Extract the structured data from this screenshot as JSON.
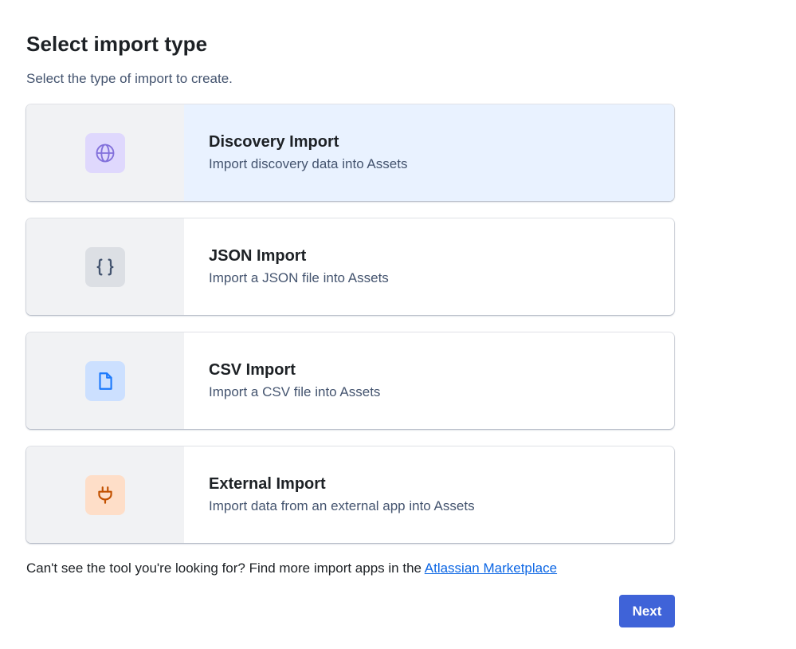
{
  "header": {
    "title": "Select import type",
    "subtitle": "Select the type of import to create."
  },
  "options": [
    {
      "title": "Discovery Import",
      "description": "Import discovery data into Assets",
      "icon": "globe-icon",
      "selected": true,
      "icon_bg": "#dfd8fd",
      "icon_color": "#8270db"
    },
    {
      "title": "JSON Import",
      "description": "Import a JSON file into Assets",
      "icon": "braces-icon",
      "selected": false,
      "icon_bg": "#dcdfe4",
      "icon_color": "#44546f"
    },
    {
      "title": "CSV Import",
      "description": "Import a CSV file into Assets",
      "icon": "file-icon",
      "selected": false,
      "icon_bg": "#cce0ff",
      "icon_color": "#1d7afc"
    },
    {
      "title": "External Import",
      "description": "Import data from an external app into Assets",
      "icon": "plug-icon",
      "selected": false,
      "icon_bg": "#fedec8",
      "icon_color": "#c25100"
    }
  ],
  "footer": {
    "text": "Can't see the tool you're looking for? Find more import apps in the ",
    "link_label": "Atlassian Marketplace"
  },
  "actions": {
    "next_label": "Next"
  },
  "colors": {
    "selected_bg": "#e9f2ff",
    "primary_button": "#3f63d8",
    "link": "#0c66e4"
  }
}
